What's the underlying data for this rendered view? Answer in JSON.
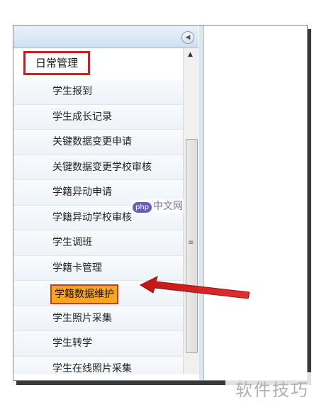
{
  "nav": {
    "group_title": "日常管理",
    "items": [
      {
        "label": "学生报到"
      },
      {
        "label": "学生成长记录"
      },
      {
        "label": "关键数据变更申请"
      },
      {
        "label": "关键数据变更学校审核"
      },
      {
        "label": "学籍异动申请"
      },
      {
        "label": "学籍异动学校审核"
      },
      {
        "label": "学生调班"
      },
      {
        "label": "学籍卡管理"
      },
      {
        "label": "学籍数据维护"
      },
      {
        "label": "学生照片采集"
      },
      {
        "label": "学生转学"
      },
      {
        "label": "学生在线照片采集"
      }
    ],
    "selected_index": 8
  },
  "icons": {
    "collapse": "collapse-left-icon",
    "scroll_up": "scroll-up-arrow-icon",
    "grip": "scroll-grip-icon"
  },
  "annotations": {
    "highlight_color": "#cc1f1f",
    "selected_fill": "#f6a623"
  },
  "watermarks": {
    "badge": "php",
    "site": "中文网",
    "corner": "软件技巧"
  }
}
